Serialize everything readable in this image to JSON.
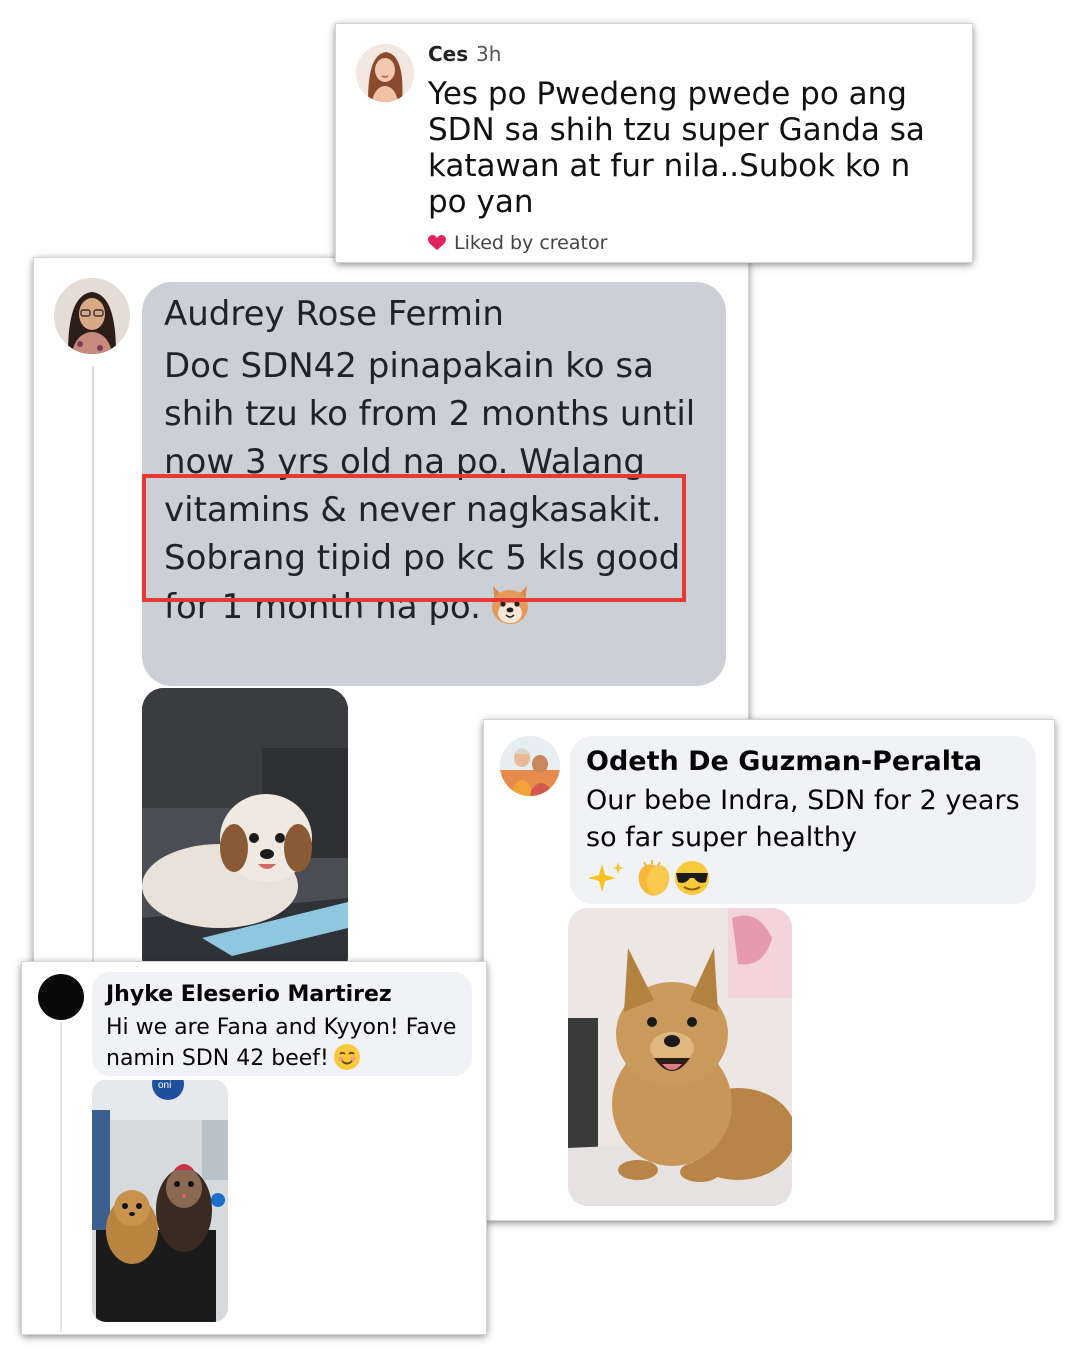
{
  "ces": {
    "name": "Ces",
    "time": "3h",
    "text": "Yes po Pwedeng pwede po ang SDN sa shih tzu super Ganda sa katawan at fur nila..Subok ko n po yan",
    "liked_label": "Liked by creator",
    "heart_icon": "heart-icon",
    "heart_color": "#e0245e"
  },
  "audrey": {
    "name": "Audrey Rose Fermin",
    "text": "Doc SDN42 pinapakain ko sa shih tzu ko from 2 months until now 3 yrs old na po. Walang vitamins & never nagkasakit. Sobrang tipid po kc 5 kls good for 1 month na po.",
    "emoji": "dog-face-emoji",
    "bubble_color": "#ccd0d6",
    "highlight_color": "#e53935"
  },
  "odeth": {
    "name": "Odeth De Guzman-Peralta",
    "text": "Our bebe Indra, SDN for 2 years so far super healthy",
    "emojis": [
      "sparkles-emoji",
      "clapping-hands-emoji",
      "sunglasses-face-emoji"
    ]
  },
  "jhyke": {
    "name": "Jhyke Eleserio Martirez",
    "text": "Hi we are Fana and Kyyon! Fave namin SDN 42 beef!",
    "emoji": "smiling-face-emoji",
    "photo_sign": "oni"
  }
}
